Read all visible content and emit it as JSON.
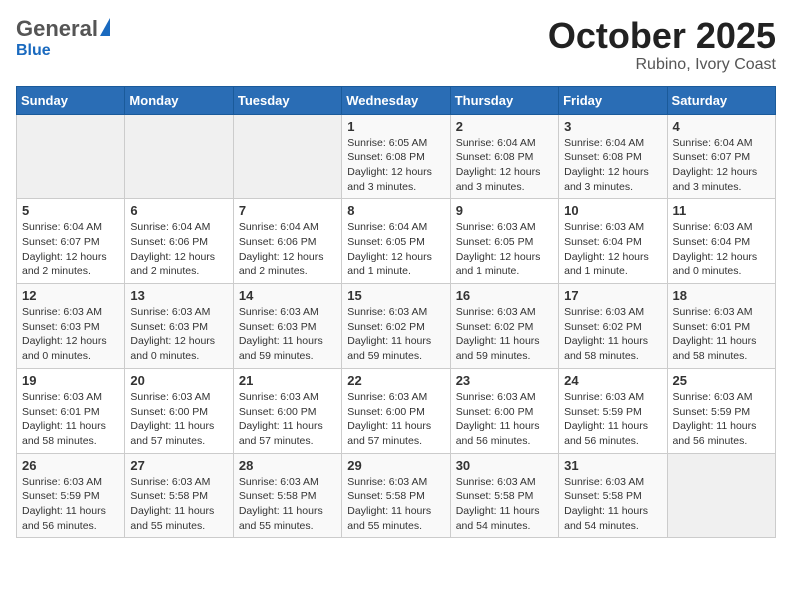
{
  "header": {
    "logo_general": "General",
    "logo_blue": "Blue",
    "month_title": "October 2025",
    "location": "Rubino, Ivory Coast"
  },
  "days_of_week": [
    "Sunday",
    "Monday",
    "Tuesday",
    "Wednesday",
    "Thursday",
    "Friday",
    "Saturday"
  ],
  "weeks": [
    [
      {
        "day": "",
        "info": ""
      },
      {
        "day": "",
        "info": ""
      },
      {
        "day": "",
        "info": ""
      },
      {
        "day": "1",
        "info": "Sunrise: 6:05 AM\nSunset: 6:08 PM\nDaylight: 12 hours\nand 3 minutes."
      },
      {
        "day": "2",
        "info": "Sunrise: 6:04 AM\nSunset: 6:08 PM\nDaylight: 12 hours\nand 3 minutes."
      },
      {
        "day": "3",
        "info": "Sunrise: 6:04 AM\nSunset: 6:08 PM\nDaylight: 12 hours\nand 3 minutes."
      },
      {
        "day": "4",
        "info": "Sunrise: 6:04 AM\nSunset: 6:07 PM\nDaylight: 12 hours\nand 3 minutes."
      }
    ],
    [
      {
        "day": "5",
        "info": "Sunrise: 6:04 AM\nSunset: 6:07 PM\nDaylight: 12 hours\nand 2 minutes."
      },
      {
        "day": "6",
        "info": "Sunrise: 6:04 AM\nSunset: 6:06 PM\nDaylight: 12 hours\nand 2 minutes."
      },
      {
        "day": "7",
        "info": "Sunrise: 6:04 AM\nSunset: 6:06 PM\nDaylight: 12 hours\nand 2 minutes."
      },
      {
        "day": "8",
        "info": "Sunrise: 6:04 AM\nSunset: 6:05 PM\nDaylight: 12 hours\nand 1 minute."
      },
      {
        "day": "9",
        "info": "Sunrise: 6:03 AM\nSunset: 6:05 PM\nDaylight: 12 hours\nand 1 minute."
      },
      {
        "day": "10",
        "info": "Sunrise: 6:03 AM\nSunset: 6:04 PM\nDaylight: 12 hours\nand 1 minute."
      },
      {
        "day": "11",
        "info": "Sunrise: 6:03 AM\nSunset: 6:04 PM\nDaylight: 12 hours\nand 0 minutes."
      }
    ],
    [
      {
        "day": "12",
        "info": "Sunrise: 6:03 AM\nSunset: 6:03 PM\nDaylight: 12 hours\nand 0 minutes."
      },
      {
        "day": "13",
        "info": "Sunrise: 6:03 AM\nSunset: 6:03 PM\nDaylight: 12 hours\nand 0 minutes."
      },
      {
        "day": "14",
        "info": "Sunrise: 6:03 AM\nSunset: 6:03 PM\nDaylight: 11 hours\nand 59 minutes."
      },
      {
        "day": "15",
        "info": "Sunrise: 6:03 AM\nSunset: 6:02 PM\nDaylight: 11 hours\nand 59 minutes."
      },
      {
        "day": "16",
        "info": "Sunrise: 6:03 AM\nSunset: 6:02 PM\nDaylight: 11 hours\nand 59 minutes."
      },
      {
        "day": "17",
        "info": "Sunrise: 6:03 AM\nSunset: 6:02 PM\nDaylight: 11 hours\nand 58 minutes."
      },
      {
        "day": "18",
        "info": "Sunrise: 6:03 AM\nSunset: 6:01 PM\nDaylight: 11 hours\nand 58 minutes."
      }
    ],
    [
      {
        "day": "19",
        "info": "Sunrise: 6:03 AM\nSunset: 6:01 PM\nDaylight: 11 hours\nand 58 minutes."
      },
      {
        "day": "20",
        "info": "Sunrise: 6:03 AM\nSunset: 6:00 PM\nDaylight: 11 hours\nand 57 minutes."
      },
      {
        "day": "21",
        "info": "Sunrise: 6:03 AM\nSunset: 6:00 PM\nDaylight: 11 hours\nand 57 minutes."
      },
      {
        "day": "22",
        "info": "Sunrise: 6:03 AM\nSunset: 6:00 PM\nDaylight: 11 hours\nand 57 minutes."
      },
      {
        "day": "23",
        "info": "Sunrise: 6:03 AM\nSunset: 6:00 PM\nDaylight: 11 hours\nand 56 minutes."
      },
      {
        "day": "24",
        "info": "Sunrise: 6:03 AM\nSunset: 5:59 PM\nDaylight: 11 hours\nand 56 minutes."
      },
      {
        "day": "25",
        "info": "Sunrise: 6:03 AM\nSunset: 5:59 PM\nDaylight: 11 hours\nand 56 minutes."
      }
    ],
    [
      {
        "day": "26",
        "info": "Sunrise: 6:03 AM\nSunset: 5:59 PM\nDaylight: 11 hours\nand 56 minutes."
      },
      {
        "day": "27",
        "info": "Sunrise: 6:03 AM\nSunset: 5:58 PM\nDaylight: 11 hours\nand 55 minutes."
      },
      {
        "day": "28",
        "info": "Sunrise: 6:03 AM\nSunset: 5:58 PM\nDaylight: 11 hours\nand 55 minutes."
      },
      {
        "day": "29",
        "info": "Sunrise: 6:03 AM\nSunset: 5:58 PM\nDaylight: 11 hours\nand 55 minutes."
      },
      {
        "day": "30",
        "info": "Sunrise: 6:03 AM\nSunset: 5:58 PM\nDaylight: 11 hours\nand 54 minutes."
      },
      {
        "day": "31",
        "info": "Sunrise: 6:03 AM\nSunset: 5:58 PM\nDaylight: 11 hours\nand 54 minutes."
      },
      {
        "day": "",
        "info": ""
      }
    ]
  ]
}
